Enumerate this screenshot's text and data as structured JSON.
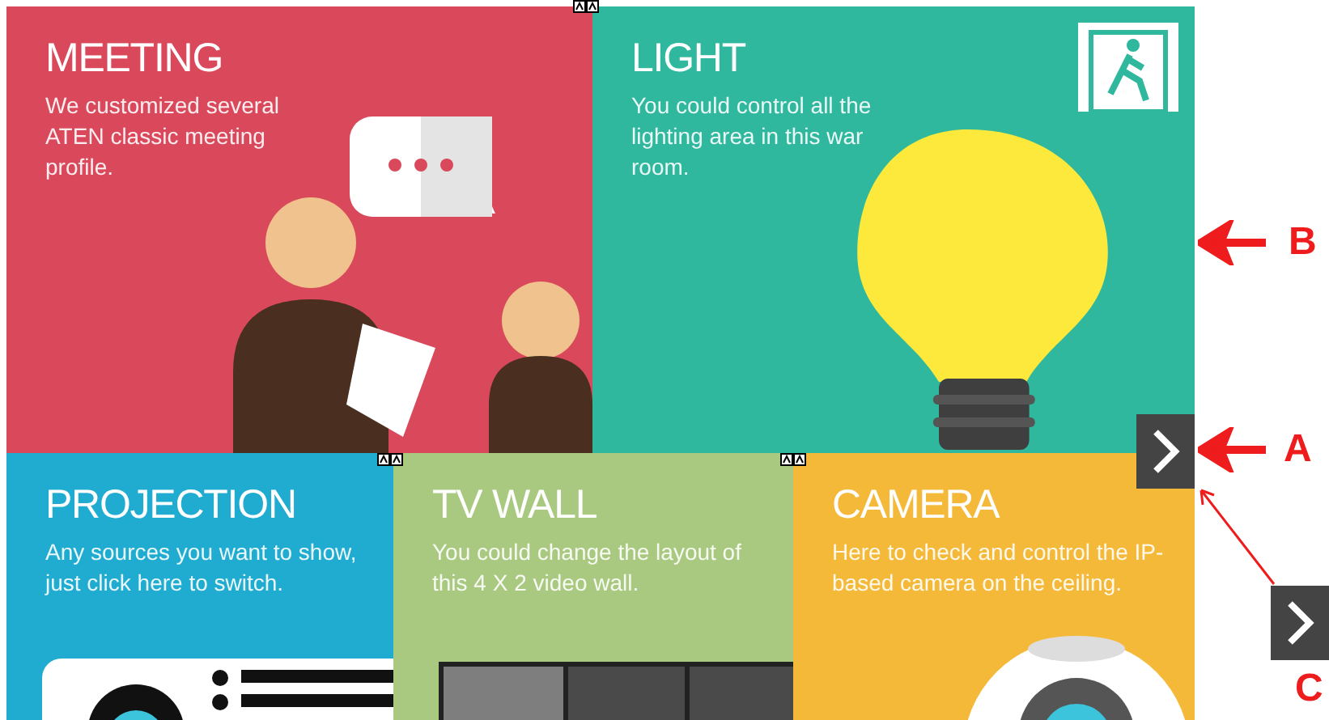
{
  "tiles": [
    {
      "kind": "meeting",
      "title": "MEETING",
      "description": "We customized several ATEN classic meeting profile.",
      "color": "#d9495b"
    },
    {
      "kind": "light",
      "title": "LIGHT",
      "description": "You could control all the lighting area in this war room.",
      "color": "#30b89f"
    },
    {
      "kind": "projection",
      "title": "PROJECTION",
      "description": "Any sources you want to show, just click here to switch.",
      "color": "#20acd0"
    },
    {
      "kind": "tvwall",
      "title": "TV WALL",
      "description": "You could change the layout of this 4 X 2 video wall.",
      "color": "#a8c97f"
    },
    {
      "kind": "camera",
      "title": "CAMERA",
      "description": "Here to check and control the IP-based camera on the ceiling.",
      "color": "#f5b93a"
    }
  ],
  "annotations": [
    "B",
    "A",
    "C"
  ]
}
